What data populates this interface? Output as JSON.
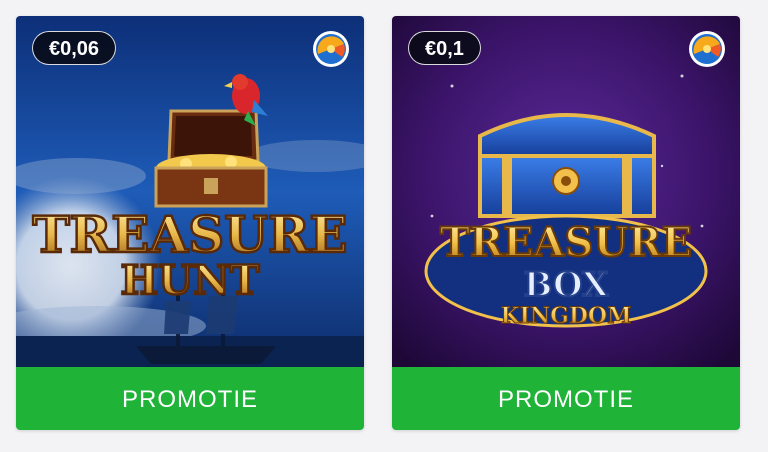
{
  "cards": [
    {
      "price": "€0,06",
      "title_line1": "TREASURE",
      "title_line2": "HUNT",
      "button_label": "PROMOTIE",
      "colors": {
        "sky": "#1a4fa6",
        "title": "#e8b84a",
        "button": "#1fb338"
      }
    },
    {
      "price": "€0,1",
      "title_line1": "TREASURE",
      "title_line2": "BOX",
      "title_line3": "KINGDOM",
      "button_label": "PROMOTIE",
      "colors": {
        "background": "#3b1469",
        "title": "#f2c14b",
        "button": "#1fb338"
      }
    }
  ]
}
